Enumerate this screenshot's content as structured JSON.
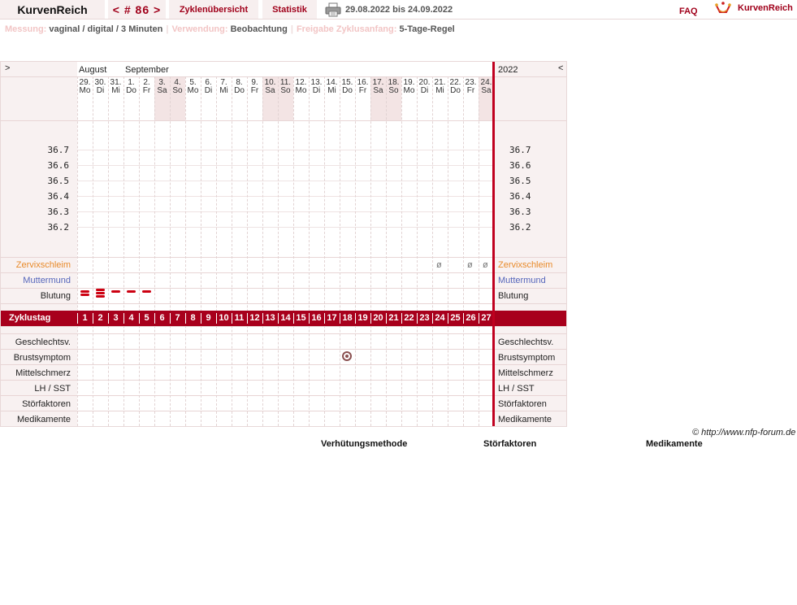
{
  "header": {
    "title": "KurvenReich",
    "cycle_nav": "< # 86 >",
    "tab_overview": "Zyklenübersicht",
    "tab_stats": "Statistik",
    "date_range": "29.08.2022 bis 24.09.2022",
    "faq": "FAQ",
    "brand": "KurvenReich",
    "print_icon": "printer-icon",
    "logo_icon": "crown-curve-logo",
    "accent_color": "#a0001a"
  },
  "info": {
    "measure_label": "Messung:",
    "measure_value": "vaginal / digital / 3 Minuten",
    "usage_label": "Verwendung:",
    "usage_value": "Beobachtung",
    "release_label": "Freigabe Zyklusanfang:",
    "release_value": "5-Tage-Regel"
  },
  "chart": {
    "nav_next": ">",
    "nav_prev": "<",
    "year": "2022",
    "months": [
      "August",
      "September"
    ],
    "days": [
      {
        "d": "29.",
        "w": "Mo",
        "we": false
      },
      {
        "d": "30.",
        "w": "Di",
        "we": false
      },
      {
        "d": "31.",
        "w": "Mi",
        "we": false
      },
      {
        "d": "1.",
        "w": "Do",
        "we": false
      },
      {
        "d": "2.",
        "w": "Fr",
        "we": false
      },
      {
        "d": "3.",
        "w": "Sa",
        "we": true
      },
      {
        "d": "4.",
        "w": "So",
        "we": true
      },
      {
        "d": "5.",
        "w": "Mo",
        "we": false
      },
      {
        "d": "6.",
        "w": "Di",
        "we": false
      },
      {
        "d": "7.",
        "w": "Mi",
        "we": false
      },
      {
        "d": "8.",
        "w": "Do",
        "we": false
      },
      {
        "d": "9.",
        "w": "Fr",
        "we": false
      },
      {
        "d": "10.",
        "w": "Sa",
        "we": true
      },
      {
        "d": "11.",
        "w": "So",
        "we": true
      },
      {
        "d": "12.",
        "w": "Mo",
        "we": false
      },
      {
        "d": "13.",
        "w": "Di",
        "we": false
      },
      {
        "d": "14.",
        "w": "Mi",
        "we": false
      },
      {
        "d": "15.",
        "w": "Do",
        "we": false
      },
      {
        "d": "16.",
        "w": "Fr",
        "we": false
      },
      {
        "d": "17.",
        "w": "Sa",
        "we": true
      },
      {
        "d": "18.",
        "w": "So",
        "we": true
      },
      {
        "d": "19.",
        "w": "Mo",
        "we": false
      },
      {
        "d": "20.",
        "w": "Di",
        "we": false
      },
      {
        "d": "21.",
        "w": "Mi",
        "we": false
      },
      {
        "d": "22.",
        "w": "Do",
        "we": false
      },
      {
        "d": "23.",
        "w": "Fr",
        "we": false
      },
      {
        "d": "24.",
        "w": "Sa",
        "we": true
      }
    ],
    "temps": [
      "36.7",
      "36.6",
      "36.5",
      "36.4",
      "36.3",
      "36.2"
    ],
    "rows_upper": [
      "Zervixschleim",
      "Muttermund",
      "Blutung"
    ],
    "cycle_label": "Zyklustag",
    "cycle_days": [
      "1",
      "2",
      "3",
      "4",
      "5",
      "6",
      "7",
      "8",
      "9",
      "10",
      "11",
      "12",
      "13",
      "14",
      "15",
      "16",
      "17",
      "18",
      "19",
      "20",
      "21",
      "22",
      "23",
      "24",
      "25",
      "26",
      "27"
    ],
    "rows_lower": [
      "Geschlechtsv.",
      "Brustsymptom",
      "Mittelschmerz",
      "LH / SST",
      "Störfaktoren",
      "Medikamente"
    ],
    "cervix_marks": [
      {
        "day": 24,
        "symbol": "ø"
      },
      {
        "day": 26,
        "symbol": "ø"
      },
      {
        "day": 27,
        "symbol": "ø"
      }
    ],
    "bleeding": [
      {
        "day": 1,
        "level": 2
      },
      {
        "day": 2,
        "level": 3
      },
      {
        "day": 3,
        "level": 1
      },
      {
        "day": 4,
        "level": 1
      },
      {
        "day": 5,
        "level": 1
      }
    ],
    "breast_marks": [
      {
        "day": 18,
        "icon": "breast-symptom-icon"
      }
    ],
    "today_line_color": "#c0001f"
  },
  "footer": {
    "copyright": "© http://www.nfp-forum.de",
    "col1": "Verhütungsmethode",
    "col2": "Störfaktoren",
    "col3": "Medikamente"
  }
}
